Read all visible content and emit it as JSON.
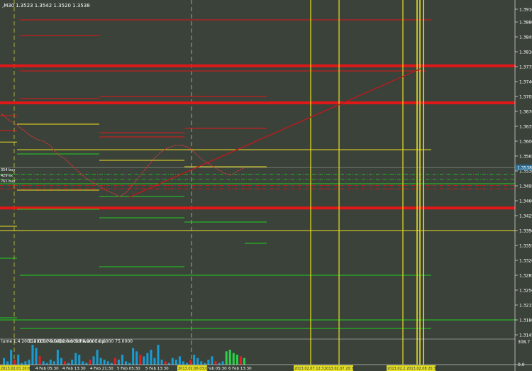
{
  "header": {
    "symbol_tf": ",M30",
    "ohlc": "1.3523 1.3542 1.3520 1.3538"
  },
  "colors": {
    "background": "#3b423a",
    "grid_dash": "#7f8a7d",
    "axis_text": "#ffffff",
    "level_red": "#e01818",
    "level_yellow": "#f0e020",
    "level_green": "#20d020",
    "trend": "#b81c1c",
    "vline_yellow": "#e8e020",
    "price_line": "#c93a3a",
    "volume_blue": "#1a9bd0",
    "volume_red": "#e02020",
    "volume_green": "#2bd24a"
  },
  "price_labels": [
    "1.3910",
    "1.3880",
    "1.3845",
    "1.3810",
    "1.3775",
    "1.3740",
    "1.3705",
    "1.3670",
    "1.3635",
    "1.3600",
    "1.3565",
    "1.3530",
    "1.3495",
    "1.3460",
    "1.3425",
    "1.3390",
    "1.3355",
    "1.3320",
    "1.3285",
    "1.3250",
    "1.3215",
    "1.3180",
    "1.3145"
  ],
  "current_price_label": "1.3538",
  "time_labels": [
    "4 Feb 05:30",
    "4 Feb 13:30",
    "4 Feb 21:30",
    "5 Feb 05:30",
    "5 Feb 13:30",
    "6 Feb 05:30",
    "6 Feb 13:30"
  ],
  "highlighted_time_labels": [
    "2013.02.01 20:00",
    "2013.02.06 03:00",
    "2013.02.07 12:30",
    "2013.02.07 20:30",
    "2013.02.2",
    "2013.02.08 20:30"
  ],
  "order_labels": [
    "354 buy",
    "429 ex",
    "761 buy"
  ],
  "volume": {
    "label": "lume 1.4 2001-2013, MetaQuotes Software Corp.",
    "indicator_values": "110.0000 0.0000 0.0000 0.0000 0.0000 75.0000",
    "scale_top": "308.7",
    "scale_bottom": "0.0"
  },
  "chart_data": {
    "type": "line",
    "title": "",
    "ylim": [
      1.3135,
      1.3925
    ],
    "x_ticks": [
      "4 Feb 05:30",
      "4 Feb 13:30",
      "4 Feb 21:30",
      "5 Feb 05:30",
      "5 Feb 13:30",
      "6 Feb 05:30",
      "6 Feb 13:30"
    ],
    "y_ticks": [
      1.391,
      1.388,
      1.3845,
      1.381,
      1.3775,
      1.374,
      1.3705,
      1.367,
      1.3635,
      1.36,
      1.3565,
      1.353,
      1.3495,
      1.346,
      1.3425,
      1.339,
      1.3355,
      1.332,
      1.3285,
      1.325,
      1.3215,
      1.318,
      1.3145
    ],
    "price_series": [
      1.3665,
      1.365,
      1.364,
      1.3628,
      1.3615,
      1.3605,
      1.36,
      1.359,
      1.357,
      1.356,
      1.3545,
      1.353,
      1.3515,
      1.3505,
      1.3495,
      1.3485,
      1.3478,
      1.347,
      1.348,
      1.35,
      1.352,
      1.354,
      1.356,
      1.3575,
      1.3585,
      1.359,
      1.359,
      1.3585,
      1.357,
      1.3555,
      1.3545,
      1.3535,
      1.3525,
      1.352,
      1.353,
      1.3538
    ],
    "current_price": 1.3538,
    "trendline": {
      "from": [
        0.242,
        1.3468
      ],
      "to": [
        0.79,
        1.377
      ]
    },
    "horizontal_levels": [
      {
        "price": 1.3885,
        "color": "red",
        "thickness": 1
      },
      {
        "price": 1.3848,
        "color": "red",
        "thickness": 1
      },
      {
        "price": 1.3777,
        "color": "red",
        "thickness": 4
      },
      {
        "price": 1.3765,
        "color": "red",
        "thickness": 1
      },
      {
        "price": 1.369,
        "color": "red",
        "thickness": 4
      },
      {
        "price": 1.37,
        "color": "red",
        "thickness": 1
      },
      {
        "price": 1.362,
        "color": "red",
        "thickness": 1
      },
      {
        "price": 1.358,
        "color": "yellow",
        "thickness": 1
      },
      {
        "price": 1.354,
        "color": "yellow",
        "thickness": 1
      },
      {
        "price": 1.35,
        "color": "green",
        "thickness": 1
      },
      {
        "price": 1.3443,
        "color": "red",
        "thickness": 4
      },
      {
        "price": 1.339,
        "color": "yellow",
        "thickness": 1
      },
      {
        "price": 1.3285,
        "color": "green",
        "thickness": 1
      },
      {
        "price": 1.318,
        "color": "green",
        "thickness": 1
      },
      {
        "price": 1.316,
        "color": "green",
        "thickness": 1
      }
    ],
    "vertical_markers": [
      "2013.02.01 20:00",
      "2013.02.06 03:00",
      "2013.02.07 12:30",
      "2013.02.07 20:30",
      "2013.02.2",
      "2013.02.08 20:30"
    ],
    "volume_bars": [
      4,
      2,
      9,
      3,
      6,
      1,
      2,
      3,
      12,
      10,
      5,
      2,
      1,
      3,
      2,
      9,
      4,
      2,
      1,
      3,
      7,
      6,
      2,
      1,
      3,
      5,
      9,
      4,
      3,
      2,
      1,
      4,
      3,
      6,
      2,
      1,
      10,
      8,
      6,
      5,
      7,
      9,
      4,
      12,
      3,
      2,
      1,
      4,
      3,
      5,
      2,
      1,
      3,
      6,
      4,
      2,
      1,
      3,
      5,
      2,
      1,
      2,
      8,
      9,
      7,
      6,
      5,
      4
    ]
  }
}
